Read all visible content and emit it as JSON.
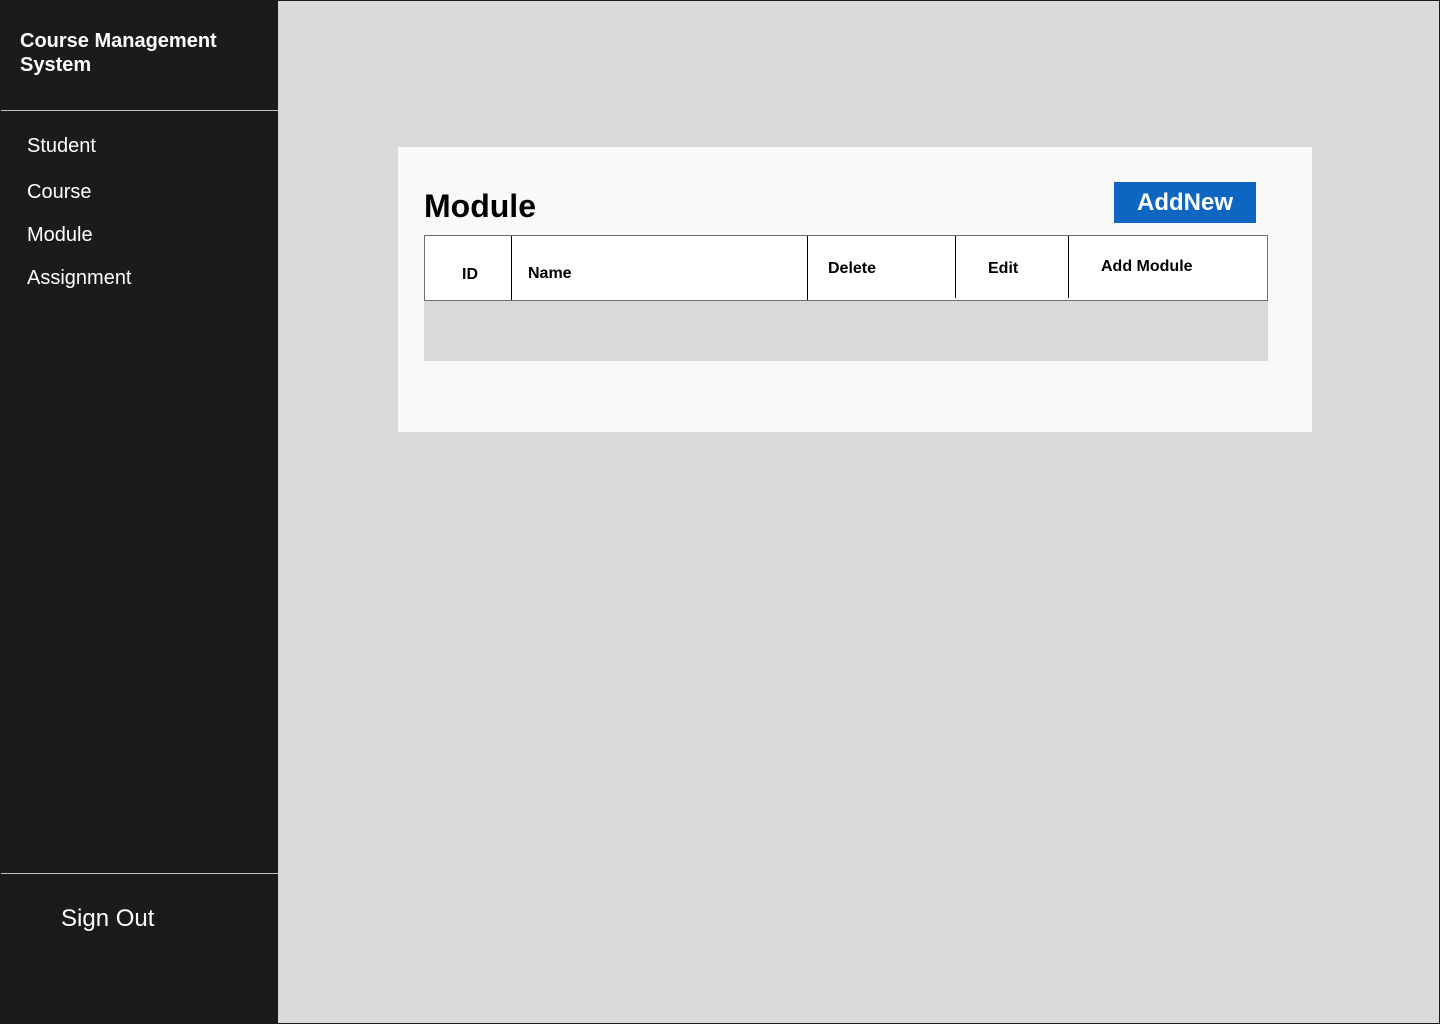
{
  "app": {
    "title": "Course Management System"
  },
  "sidebar": {
    "items": [
      {
        "label": "Student"
      },
      {
        "label": "Course"
      },
      {
        "label": "Module"
      },
      {
        "label": "Assignment"
      }
    ],
    "signout_label": "Sign Out"
  },
  "main": {
    "title": "Module",
    "add_button_label": "AddNew",
    "table": {
      "columns": [
        "ID",
        "Name",
        "Delete",
        "Edit",
        "Add Module"
      ],
      "rows": []
    }
  },
  "colors": {
    "sidebar_bg": "#1b1b1b",
    "content_bg": "#d9d9d9",
    "panel_bg": "#faf9fa",
    "accent": "#0d66c2"
  }
}
